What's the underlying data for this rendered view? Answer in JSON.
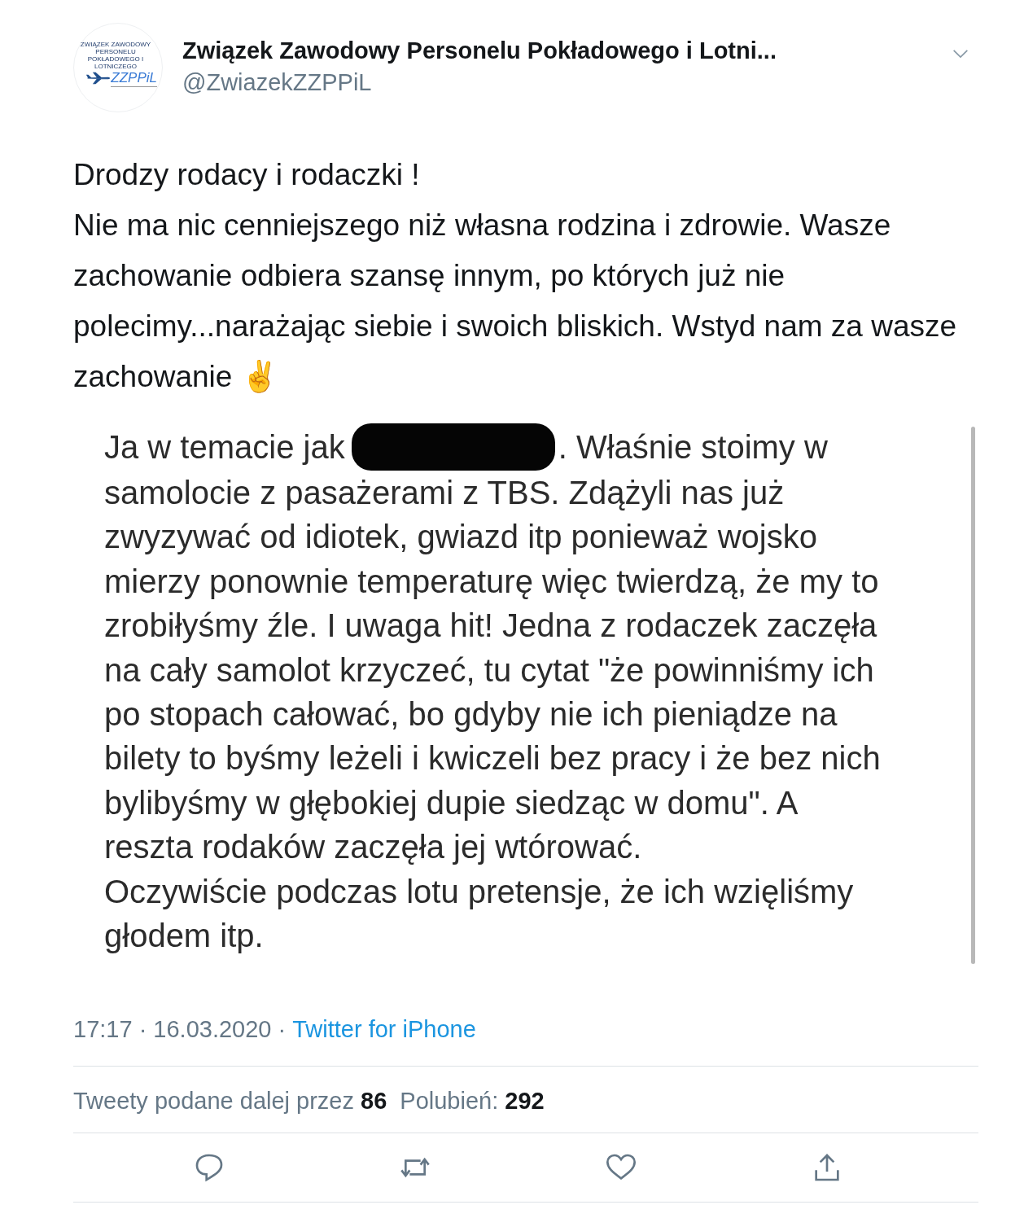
{
  "author": {
    "name": "Związek Zawodowy Personelu Pokładowego i Lotni...",
    "handle": "@ZwiazekZZPPiL",
    "avatar": {
      "line_1": "ZWIĄZEK ZAWODOWY PERSONELU",
      "line_2": "POKŁADOWEGO I LOTNICZEGO",
      "logo": "ZZPPiL"
    }
  },
  "tweet": {
    "lines": [
      "Drodzy rodacy i rodaczki !",
      "Nie ma nic cenniejszego niż własna rodzina i zdrowie. Wasze zachowanie odbiera szansę innym, po których już nie polecimy...narażając siebie i swoich bliskich. Wstyd nam za wasze zachowanie ✌️"
    ]
  },
  "embedded_screenshot": {
    "first_line": {
      "before": "Ja w temacie jak",
      "after": ". Właśnie stoimy w"
    },
    "lines": [
      "samolocie z pasażerami z TBS. Zdążyli nas już",
      "zwyzywać od idiotek, gwiazd itp ponieważ wojsko",
      "mierzy ponownie temperaturę więc twierdzą, że my to",
      "zrobiłyśmy źle. I uwaga hit! Jedna z rodaczek zaczęła",
      "na cały samolot krzyczeć, tu cytat \"że powinniśmy ich",
      "po stopach całować, bo gdyby nie ich pieniądze na",
      "bilety to byśmy leżeli i kwiczeli bez pracy i że bez nich",
      "bylibyśmy w głębokiej dupie siedząc w domu\". A",
      "reszta rodaków zaczęła jej wtórować.",
      "Oczywiście podczas lotu pretensje, że ich wzięliśmy",
      "głodem itp."
    ]
  },
  "meta": {
    "time": "17:17",
    "separator": "·",
    "date": "16.03.2020",
    "source": "Twitter for iPhone"
  },
  "stats": [
    {
      "label": "Tweety podane dalej przez",
      "count": "86"
    },
    {
      "label": "Polubień:",
      "count": "292"
    }
  ],
  "actions": [
    {
      "kind": "reply"
    },
    {
      "kind": "retweet"
    },
    {
      "kind": "like"
    },
    {
      "kind": "share"
    }
  ]
}
